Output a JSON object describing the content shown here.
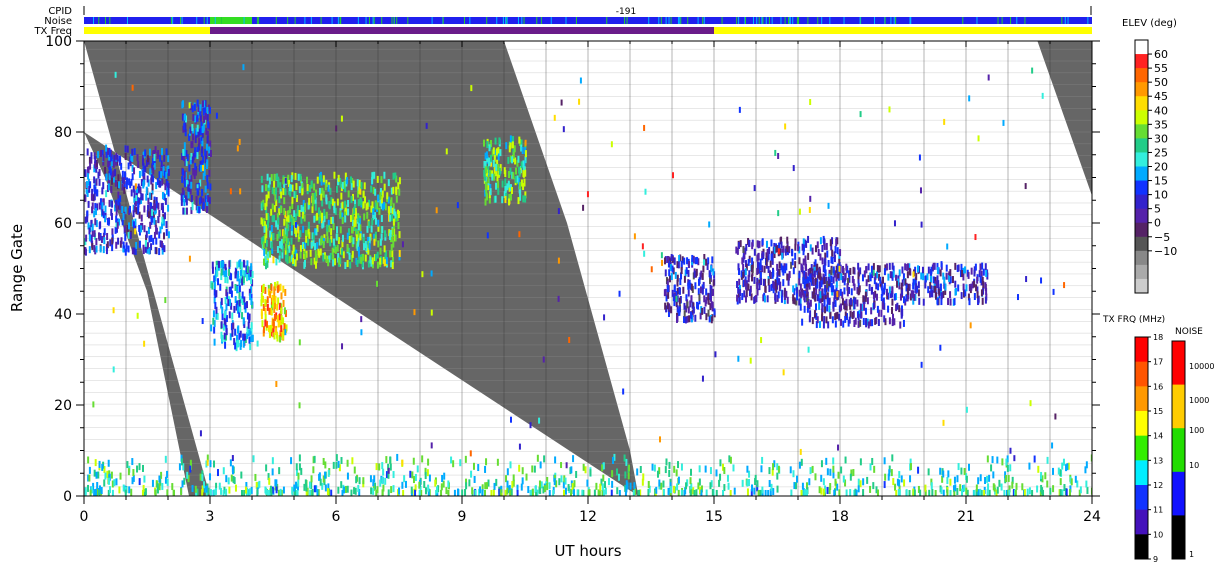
{
  "header": {
    "cpid_label": "CPID",
    "noise_label": "Noise",
    "txfreq_label": "TX Freq",
    "cpid_value": "-191"
  },
  "chart_data": {
    "type": "heatmap",
    "xlabel": "UT hours",
    "ylabel": "Range Gate",
    "xlim": [
      0,
      24
    ],
    "ylim": [
      0,
      100
    ],
    "xticks": [
      0,
      3,
      6,
      9,
      12,
      15,
      18,
      21,
      24
    ],
    "yticks": [
      0,
      20,
      40,
      60,
      80,
      100
    ],
    "grid": "vertical lines every 1 UT hour",
    "ground_scatter_gray_region": {
      "color": "#666666",
      "boundary_left": [
        [
          0,
          80
        ],
        [
          0.5,
          70
        ],
        [
          1.5,
          45
        ],
        [
          2.5,
          0
        ],
        [
          3.0,
          0
        ]
      ],
      "boundary_right": [
        [
          10.0,
          100
        ],
        [
          11.5,
          60
        ],
        [
          13.0,
          10
        ],
        [
          13.2,
          0
        ]
      ],
      "top_right_patch": [
        [
          22.7,
          100
        ],
        [
          24,
          100
        ],
        [
          24,
          66
        ]
      ]
    },
    "scatter_patches": [
      {
        "x": [
          0.0,
          2.0
        ],
        "y": [
          53,
          76
        ],
        "value_deg": 12
      },
      {
        "x": [
          2.3,
          3.0
        ],
        "y": [
          62,
          86
        ],
        "value_deg": 14
      },
      {
        "x": [
          3.0,
          4.0
        ],
        "y": [
          32,
          51
        ],
        "value_deg": 18
      },
      {
        "x": [
          4.2,
          4.8
        ],
        "y": [
          34,
          46
        ],
        "value_deg": 48
      },
      {
        "x": [
          4.2,
          7.5
        ],
        "y": [
          50,
          70
        ],
        "value_deg": 32
      },
      {
        "x": [
          9.5,
          10.5
        ],
        "y": [
          64,
          78
        ],
        "value_deg": 32
      },
      {
        "x": [
          13.8,
          15.0
        ],
        "y": [
          38,
          52
        ],
        "value_deg": 8
      },
      {
        "x": [
          15.5,
          18.0
        ],
        "y": [
          42,
          56
        ],
        "value_deg": 8
      },
      {
        "x": [
          17.0,
          19.5
        ],
        "y": [
          37,
          50
        ],
        "value_deg": 8
      },
      {
        "x": [
          19.5,
          21.5
        ],
        "y": [
          42,
          50
        ],
        "value_deg": 10
      },
      {
        "x": [
          0,
          24
        ],
        "y": [
          0,
          8
        ],
        "value_deg": 28
      }
    ],
    "elevation_colorbar": {
      "title": "ELEV (deg)",
      "labels": [
        "60",
        "55",
        "50",
        "45",
        "40",
        "35",
        "30",
        "25",
        "20",
        "15",
        "10",
        "5",
        "0",
        "−5",
        "−10"
      ],
      "colors": [
        "#ffffff",
        "#ff2222",
        "#ff6600",
        "#ff9900",
        "#ffdd00",
        "#ccff00",
        "#66dd33",
        "#22cc88",
        "#33eedd",
        "#00aaff",
        "#1133ff",
        "#3322cc",
        "#5522aa",
        "#552266",
        "#555555",
        "#888888",
        "#aaaaaa",
        "#cccccc"
      ]
    },
    "txfreq_colorbar": {
      "title": "TX FRQ (MHz)",
      "labels": [
        "18",
        "17",
        "16",
        "15",
        "14",
        "13",
        "12",
        "11",
        "10",
        "9"
      ],
      "colors": [
        "#ff0000",
        "#ff5500",
        "#ff9900",
        "#ffff00",
        "#33ee00",
        "#00eeff",
        "#1133ff",
        "#4411bb",
        "#000000"
      ]
    },
    "noise_colorbar": {
      "title": "NOISE",
      "labels": [
        "10000",
        "1000",
        "100",
        "10",
        "1"
      ],
      "colors": [
        "#ff0000",
        "#ffcc00",
        "#22dd00",
        "#1111ff",
        "#000000"
      ]
    },
    "top_bars": {
      "noise_base_color": "#2020ee",
      "noise_green_segment_hours": [
        3.0,
        4.0
      ],
      "txfreq_base_color": "#ffff00",
      "txfreq_purple_segment_hours": [
        3.0,
        15.0
      ],
      "txfreq_purple_color": "#6a1c8a"
    }
  }
}
